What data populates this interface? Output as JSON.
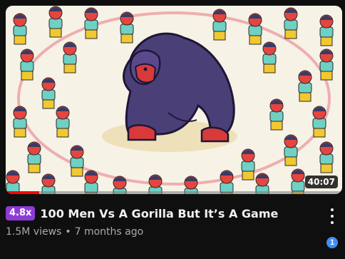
{
  "video": {
    "duration": "40:07",
    "speed": "4.8x",
    "title": "100 Men Vs A Gorilla But It’s A Game",
    "views": "1.5M views",
    "separator": "•",
    "age": "7 months ago",
    "watch_progress_percent": 10,
    "notification_count": "1"
  },
  "icons": {
    "more": "vertical-ellipsis-icon"
  },
  "colors": {
    "background": "#0f0f0f",
    "speed_badge": "#8e3bd6",
    "progress": "#ff0000",
    "notification": "#3e8ef7",
    "gorilla": "#4b3f78",
    "men_skin": "#e5453f",
    "men_shirt": "#6fd0c4",
    "men_pants": "#f2c830"
  }
}
